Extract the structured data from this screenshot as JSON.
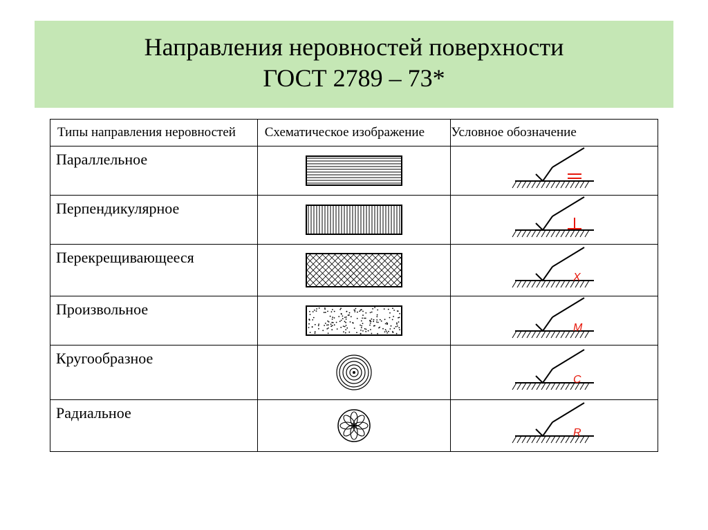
{
  "title_line1": "Направления неровностей поверхности",
  "title_line2": "ГОСТ 2789 – 73*",
  "headers": {
    "col1": "Типы направления неровностей",
    "col2": "Схематическое изображение",
    "col3": "Условное обозначение"
  },
  "rows": [
    {
      "name": "Параллельное",
      "symbol_letter": "=",
      "schem": "parallel",
      "sym": "parallel"
    },
    {
      "name": "Перпендикулярное",
      "symbol_letter": "⊥",
      "schem": "perpend",
      "sym": "perpend"
    },
    {
      "name": "Перекрещивающееся",
      "symbol_letter": "X",
      "schem": "cross",
      "sym": "letter"
    },
    {
      "name": "Произвольное",
      "symbol_letter": "M",
      "schem": "random",
      "sym": "letter"
    },
    {
      "name": "Кругообразное",
      "symbol_letter": "C",
      "schem": "circular",
      "sym": "letter"
    },
    {
      "name": "Радиальное",
      "symbol_letter": "R",
      "schem": "radial",
      "sym": "letter"
    }
  ],
  "colors": {
    "title_bg": "#c5e7b5",
    "red": "#e6170a",
    "black": "#000"
  }
}
